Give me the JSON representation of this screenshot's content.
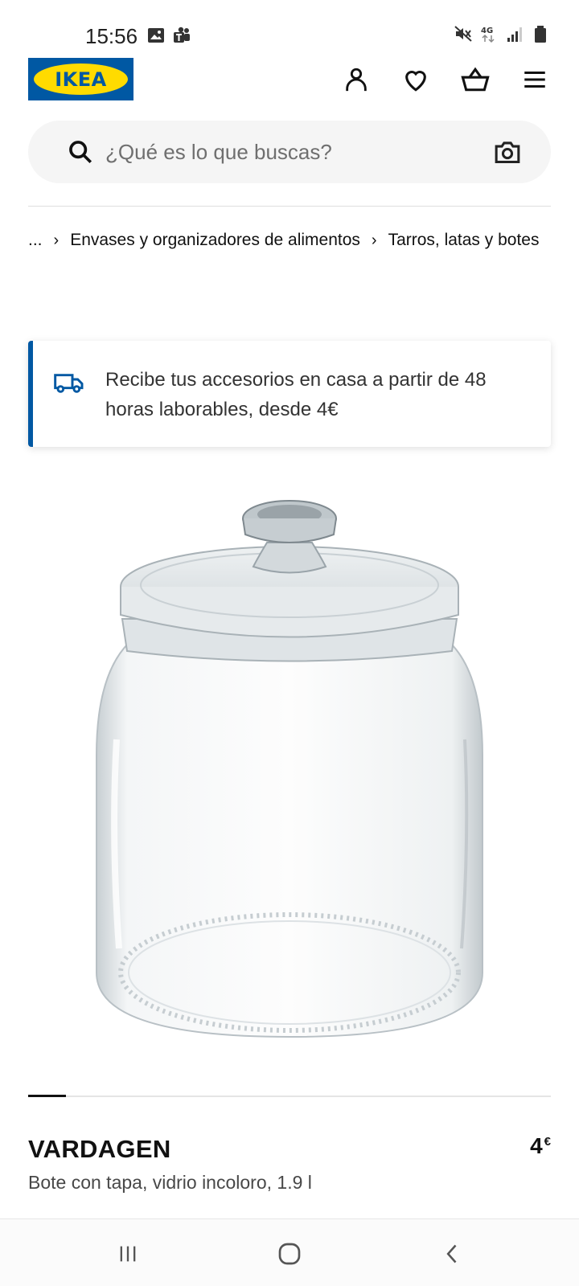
{
  "status_bar": {
    "time": "15:56",
    "left_icons": [
      "image-icon",
      "teams-icon"
    ],
    "right_icons": [
      "mute-icon",
      "network-4g-icon",
      "signal-icon",
      "battery-icon"
    ],
    "network_label": "4G"
  },
  "header": {
    "logo_text": "IKEA",
    "icons": [
      "profile-icon",
      "heart-icon",
      "basket-icon",
      "menu-icon"
    ]
  },
  "search": {
    "placeholder": "¿Qué es lo que buscas?",
    "value": ""
  },
  "breadcrumb": {
    "ellipsis": "...",
    "separator": "›",
    "items": [
      "Envases y organizadores de alimentos",
      "Tarros, latas y botes"
    ]
  },
  "banner": {
    "text": "Recibe tus accesorios en casa a partir de 48 horas laborables, desde 4€"
  },
  "product": {
    "name": "VARDAGEN",
    "description": "Bote con tapa, vidrio incoloro, 1.9 l",
    "price": "4",
    "currency": "€",
    "image_alt": "Glass jar with lid"
  },
  "carousel": {
    "active_index": 0
  },
  "colors": {
    "ikea_blue": "#0058a3",
    "ikea_yellow": "#ffdb00",
    "text_primary": "#111111",
    "text_secondary": "#484848"
  }
}
